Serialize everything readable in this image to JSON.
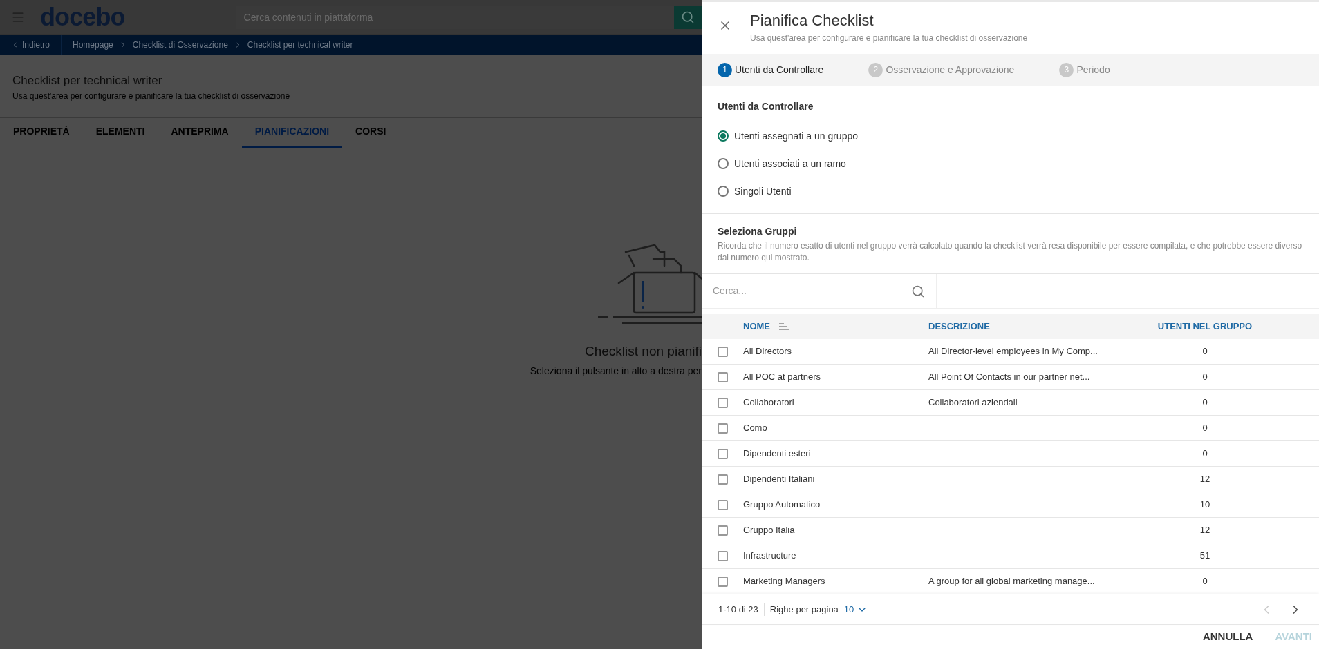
{
  "background_page": {
    "logo": "docebo",
    "search_placeholder": "Cerca contenuti in piattaforma",
    "back": "Indietro",
    "breadcrumb": [
      "Homepage",
      "Checklist di Osservazione",
      "Checklist per technical writer"
    ],
    "title": "Checklist per technical writer",
    "subtitle": "Usa quest'area per configurare e pianificare la tua checklist di osservazione",
    "tabs": [
      {
        "label": "PROPRIETÀ",
        "selected": false
      },
      {
        "label": "ELEMENTI",
        "selected": false
      },
      {
        "label": "ANTEPRIMA",
        "selected": false
      },
      {
        "label": "PIANIFICAZIONI",
        "selected": true
      },
      {
        "label": "CORSI",
        "selected": false
      }
    ],
    "empty_title": "Checklist non pianifi",
    "empty_text": "Seleziona il pulsante in alto a destra per"
  },
  "panel": {
    "title": "Pianifica Checklist",
    "subtitle": "Usa quest'area per configurare e pianificare la tua checklist di osservazione",
    "steps": [
      {
        "number": "1",
        "label": "Utenti da Controllare",
        "selected": true
      },
      {
        "number": "2",
        "label": "Osservazione e Approvazione",
        "selected": false
      },
      {
        "number": "3",
        "label": "Periodo",
        "selected": false
      }
    ],
    "section_title": "Utenti da Controllare",
    "options": [
      {
        "label": "Utenti assegnati a un gruppo",
        "selected": true
      },
      {
        "label": "Utenti associati a un ramo",
        "selected": false
      },
      {
        "label": "Singoli Utenti",
        "selected": false
      }
    ],
    "groups_title": "Seleziona Gruppi",
    "groups_note": "Ricorda che il numero esatto di utenti nel gruppo verrà calcolato quando la checklist verrà resa disponibile per essere compilata, e che potrebbe essere diverso dal numero qui mostrato.",
    "search_placeholder": "Cerca...",
    "columns": [
      "NOME",
      "DESCRIZIONE",
      "UTENTI NEL GRUPPO"
    ],
    "rows": [
      {
        "name": "All Directors",
        "description": "All Director-level employees in My Comp...",
        "count": "0",
        "checked": false
      },
      {
        "name": "All POC at partners",
        "description": "All Point Of Contacts in our partner net...",
        "count": "0",
        "checked": false
      },
      {
        "name": "Collaboratori",
        "description": "Collaboratori aziendali",
        "count": "0",
        "checked": false
      },
      {
        "name": "Como",
        "count": "0",
        "checked": false
      },
      {
        "name": "Dipendenti esteri",
        "count": "0",
        "checked": false
      },
      {
        "name": "Dipendenti Italiani",
        "count": "12",
        "checked": false
      },
      {
        "name": "Gruppo Automatico",
        "count": "10",
        "checked": false
      },
      {
        "name": "Gruppo Italia",
        "count": "12",
        "checked": false
      },
      {
        "name": "Infrastructure",
        "count": "51",
        "checked": false
      },
      {
        "name": "Marketing Managers",
        "description": "A group for all global marketing manage...",
        "count": "0",
        "checked": false
      }
    ],
    "range": "1-10 di 23",
    "rows_per_page_label": "Righe per pagina",
    "rows_per_page": "10",
    "buttons": [
      {
        "label": "ANNULLA",
        "disabled": false
      },
      {
        "label": "AVANTI",
        "disabled": true
      }
    ]
  }
}
